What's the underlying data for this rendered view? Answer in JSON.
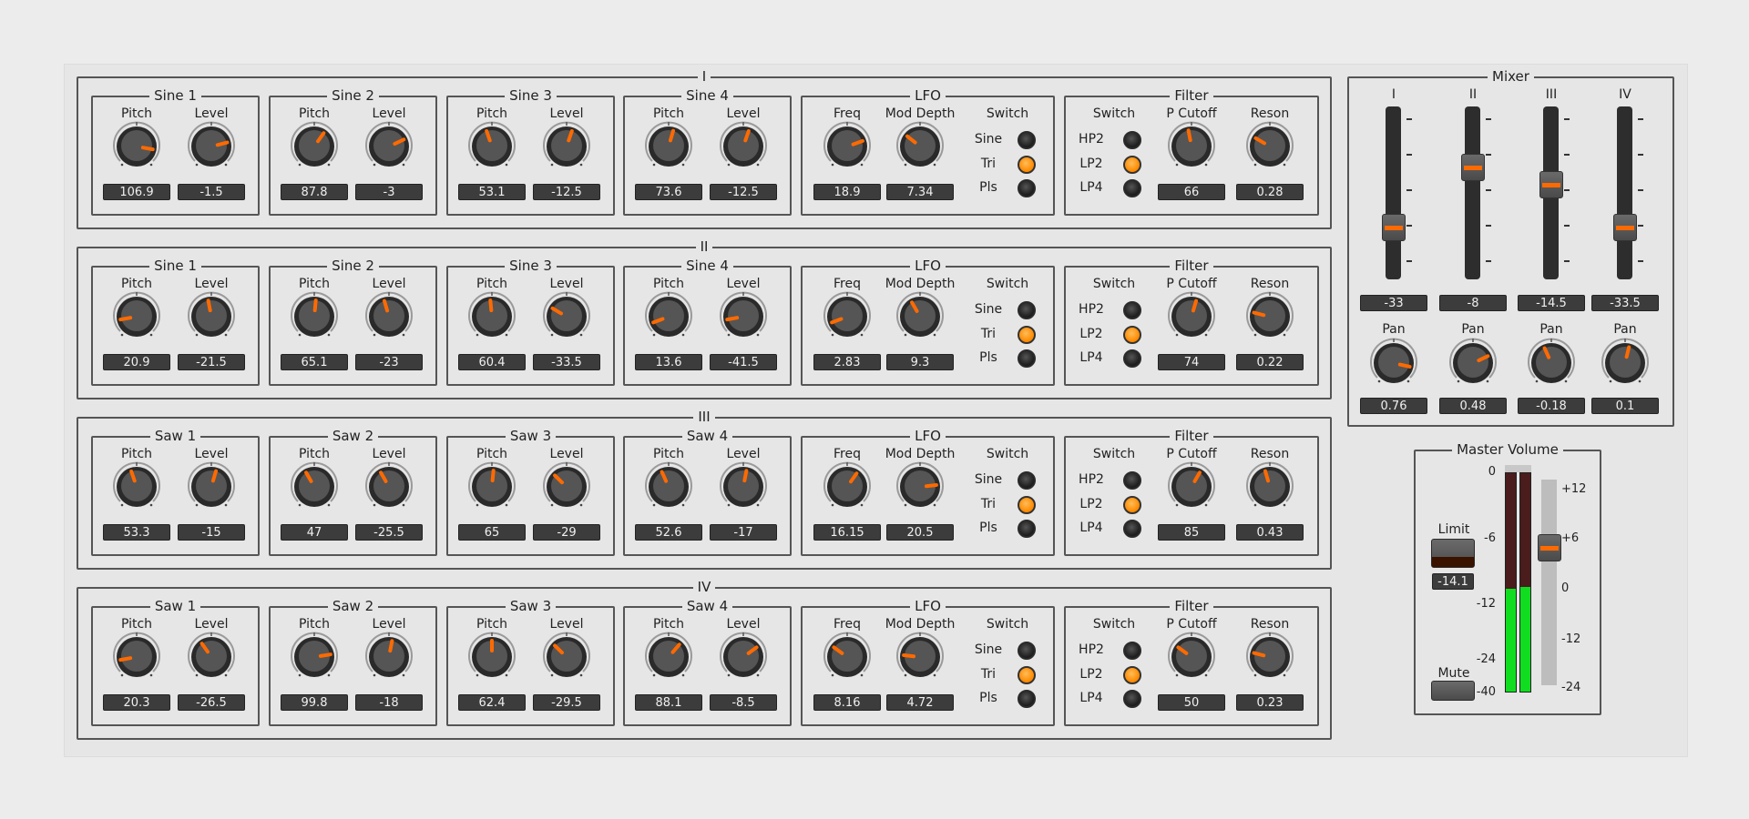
{
  "colors": {
    "accent": "#ff6a00",
    "led_on": "#ff8a00",
    "meter_green": "#10dd20",
    "meter_red": "#4a1c1c"
  },
  "groups": [
    {
      "title": "I",
      "oscs": [
        {
          "title": "Sine 1",
          "pitch_label": "Pitch",
          "level_label": "Level",
          "pitch": "106.9",
          "level": "-1.5",
          "pitch_pos": 0.87,
          "level_pos": 0.78
        },
        {
          "title": "Sine 2",
          "pitch_label": "Pitch",
          "level_label": "Level",
          "pitch": "87.8",
          "level": "-3",
          "pitch_pos": 0.63,
          "level_pos": 0.74
        },
        {
          "title": "Sine 3",
          "pitch_label": "Pitch",
          "level_label": "Level",
          "pitch": "53.1",
          "level": "-12.5",
          "pitch_pos": 0.43,
          "level_pos": 0.57
        },
        {
          "title": "Sine 4",
          "pitch_label": "Pitch",
          "level_label": "Level",
          "pitch": "73.6",
          "level": "-12.5",
          "pitch_pos": 0.56,
          "level_pos": 0.57
        }
      ],
      "lfo": {
        "title": "LFO",
        "freq_label": "Freq",
        "mod_label": "Mod Depth",
        "switch_label": "Switch",
        "freq": "18.9",
        "mod": "7.34",
        "freq_pos": 0.76,
        "mod_pos": 0.31,
        "options": [
          "Sine",
          "Tri",
          "Pls"
        ],
        "selected": 1
      },
      "filter": {
        "title": "Filter",
        "switch_label": "Switch",
        "cutoff_label": "P Cutoff",
        "reson_label": "Reson",
        "cutoff": "66",
        "reson": "0.28",
        "cutoff_pos": 0.46,
        "reson_pos": 0.28,
        "options": [
          "HP2",
          "LP2",
          "LP4"
        ],
        "selected": 1
      }
    },
    {
      "title": "II",
      "oscs": [
        {
          "title": "Sine 1",
          "pitch_label": "Pitch",
          "level_label": "Level",
          "pitch": "20.9",
          "level": "-21.5",
          "pitch_pos": 0.13,
          "level_pos": 0.46
        },
        {
          "title": "Sine 2",
          "pitch_label": "Pitch",
          "level_label": "Level",
          "pitch": "65.1",
          "level": "-23",
          "pitch_pos": 0.52,
          "level_pos": 0.44
        },
        {
          "title": "Sine 3",
          "pitch_label": "Pitch",
          "level_label": "Level",
          "pitch": "60.4",
          "level": "-33.5",
          "pitch_pos": 0.48,
          "level_pos": 0.28
        },
        {
          "title": "Sine 4",
          "pitch_label": "Pitch",
          "level_label": "Level",
          "pitch": "13.6",
          "level": "-41.5",
          "pitch_pos": 0.09,
          "level_pos": 0.13
        }
      ],
      "lfo": {
        "title": "LFO",
        "freq_label": "Freq",
        "mod_label": "Mod Depth",
        "switch_label": "Switch",
        "freq": "2.83",
        "mod": "9.3",
        "freq_pos": 0.09,
        "mod_pos": 0.39,
        "options": [
          "Sine",
          "Tri",
          "Pls"
        ],
        "selected": 1
      },
      "filter": {
        "title": "Filter",
        "switch_label": "Switch",
        "cutoff_label": "P Cutoff",
        "reson_label": "Reson",
        "cutoff": "74",
        "reson": "0.22",
        "cutoff_pos": 0.56,
        "reson_pos": 0.22,
        "options": [
          "HP2",
          "LP2",
          "LP4"
        ],
        "selected": 1
      }
    },
    {
      "title": "III",
      "oscs": [
        {
          "title": "Saw 1",
          "pitch_label": "Pitch",
          "level_label": "Level",
          "pitch": "53.3",
          "level": "-15",
          "pitch_pos": 0.43,
          "level_pos": 0.56
        },
        {
          "title": "Saw 2",
          "pitch_label": "Pitch",
          "level_label": "Level",
          "pitch": "47",
          "level": "-25.5",
          "pitch_pos": 0.39,
          "level_pos": 0.39
        },
        {
          "title": "Saw 3",
          "pitch_label": "Pitch",
          "level_label": "Level",
          "pitch": "65",
          "level": "-29",
          "pitch_pos": 0.52,
          "level_pos": 0.33
        },
        {
          "title": "Saw 4",
          "pitch_label": "Pitch",
          "level_label": "Level",
          "pitch": "52.6",
          "level": "-17",
          "pitch_pos": 0.41,
          "level_pos": 0.54
        }
      ],
      "lfo": {
        "title": "LFO",
        "freq_label": "Freq",
        "mod_label": "Mod Depth",
        "switch_label": "Switch",
        "freq": "16.15",
        "mod": "20.5",
        "freq_pos": 0.63,
        "mod_pos": 0.81,
        "options": [
          "Sine",
          "Tri",
          "Pls"
        ],
        "selected": 1
      },
      "filter": {
        "title": "Filter",
        "switch_label": "Switch",
        "cutoff_label": "P Cutoff",
        "reson_label": "Reson",
        "cutoff": "85",
        "reson": "0.43",
        "cutoff_pos": 0.61,
        "reson_pos": 0.44,
        "options": [
          "HP2",
          "LP2",
          "LP4"
        ],
        "selected": 1
      }
    },
    {
      "title": "IV",
      "oscs": [
        {
          "title": "Saw 1",
          "pitch_label": "Pitch",
          "level_label": "Level",
          "pitch": "20.3",
          "level": "-26.5",
          "pitch_pos": 0.13,
          "level_pos": 0.37
        },
        {
          "title": "Saw 2",
          "pitch_label": "Pitch",
          "level_label": "Level",
          "pitch": "99.8",
          "level": "-18",
          "pitch_pos": 0.8,
          "level_pos": 0.54
        },
        {
          "title": "Saw 3",
          "pitch_label": "Pitch",
          "level_label": "Level",
          "pitch": "62.4",
          "level": "-29.5",
          "pitch_pos": 0.5,
          "level_pos": 0.33
        },
        {
          "title": "Saw 4",
          "pitch_label": "Pitch",
          "level_label": "Level",
          "pitch": "88.1",
          "level": "-8.5",
          "pitch_pos": 0.65,
          "level_pos": 0.7
        }
      ],
      "lfo": {
        "title": "LFO",
        "freq_label": "Freq",
        "mod_label": "Mod Depth",
        "switch_label": "Switch",
        "freq": "8.16",
        "mod": "4.72",
        "freq_pos": 0.3,
        "mod_pos": 0.19,
        "options": [
          "Sine",
          "Tri",
          "Pls"
        ],
        "selected": 1
      },
      "filter": {
        "title": "Filter",
        "switch_label": "Switch",
        "cutoff_label": "P Cutoff",
        "reson_label": "Reson",
        "cutoff": "50",
        "reson": "0.23",
        "cutoff_pos": 0.3,
        "reson_pos": 0.22,
        "options": [
          "HP2",
          "LP2",
          "LP4"
        ],
        "selected": 1
      }
    }
  ],
  "mixer": {
    "title": "Mixer",
    "channels": [
      {
        "label": "I",
        "volume": "-33",
        "fader_pos": 0.3,
        "pan_label": "Pan",
        "pan": "0.76",
        "pan_pos": 0.88
      },
      {
        "label": "II",
        "volume": "-8",
        "fader_pos": 0.65,
        "pan_label": "Pan",
        "pan": "0.48",
        "pan_pos": 0.74
      },
      {
        "label": "III",
        "volume": "-14.5",
        "fader_pos": 0.55,
        "pan_label": "Pan",
        "pan": "-0.18",
        "pan_pos": 0.41
      },
      {
        "label": "IV",
        "volume": "-33.5",
        "fader_pos": 0.3,
        "pan_label": "Pan",
        "pan": "0.1",
        "pan_pos": 0.55
      }
    ]
  },
  "master": {
    "title": "Master Volume",
    "limit_label": "Limit",
    "limit_value": "-14.1",
    "mute_label": "Mute",
    "meter_scale": [
      "0",
      "-6",
      "-12",
      "-24",
      "-40"
    ],
    "fader_scale": [
      "+12",
      "+6",
      "0",
      "-12",
      "-24"
    ],
    "meter_levels": [
      0.47,
      0.48
    ],
    "fader_pos": 0.67
  }
}
